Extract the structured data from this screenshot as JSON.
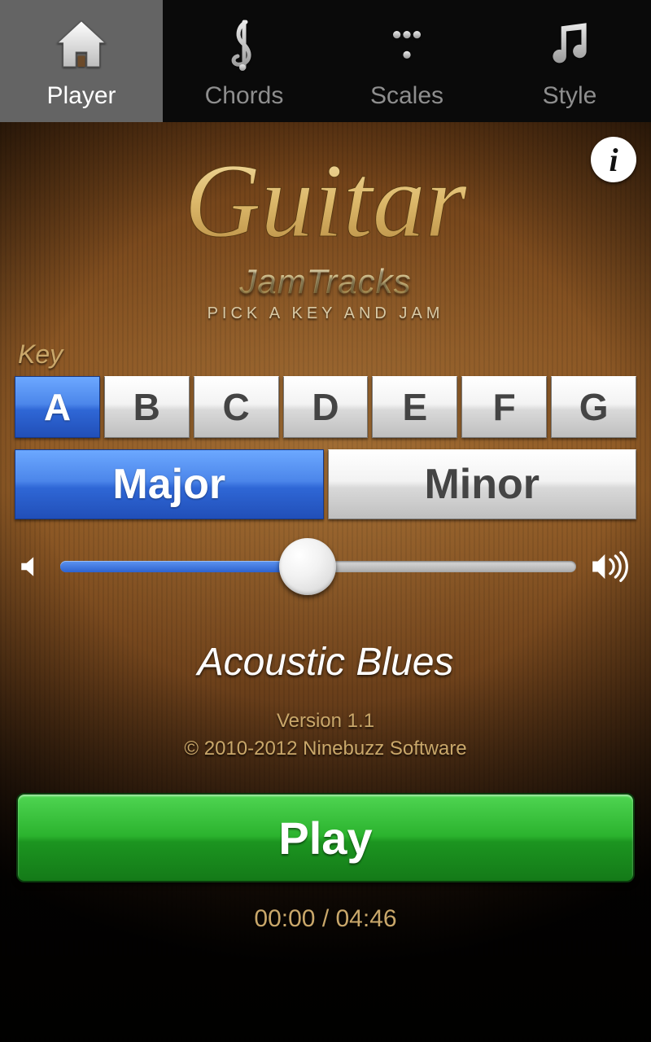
{
  "tabs": {
    "player": "Player",
    "chords": "Chords",
    "scales": "Scales",
    "style": "Style",
    "active": "player"
  },
  "logo": {
    "script": "Guitar",
    "sub": "JamTracks",
    "tag": "PICK A KEY AND JAM"
  },
  "key_section": {
    "label": "Key",
    "notes": [
      "A",
      "B",
      "C",
      "D",
      "E",
      "F",
      "G"
    ],
    "selected_note": "A",
    "modes": [
      "Major",
      "Minor"
    ],
    "selected_mode": "Major"
  },
  "volume": {
    "percent": 48
  },
  "track": {
    "name": "Acoustic Blues"
  },
  "about": {
    "version": "Version 1.1",
    "copyright": "© 2010-2012 Ninebuzz Software"
  },
  "play_label": "Play",
  "time": {
    "current": "00:00",
    "total": "04:46",
    "sep": " / "
  },
  "info_glyph": "i"
}
